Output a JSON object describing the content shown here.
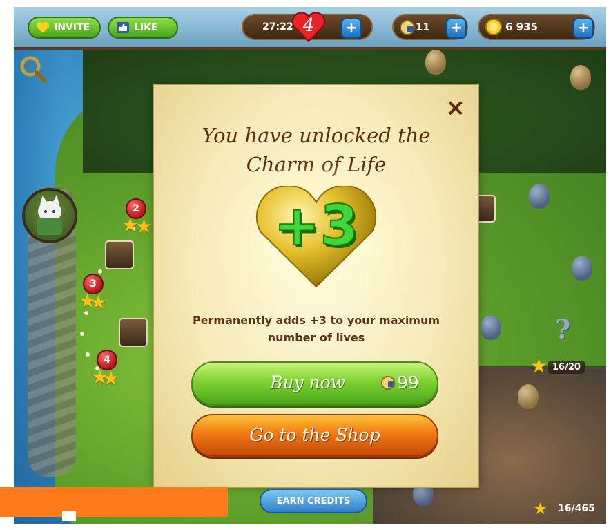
{
  "topbar": {
    "invite_label": "INVITE",
    "like_label": "LIKE",
    "timer": "27:22",
    "lives": "4",
    "credits": "11",
    "coins": "6 935"
  },
  "map": {
    "levels": [
      "2",
      "3",
      "4"
    ],
    "star_counter": "16/20",
    "total_stars": "16/465"
  },
  "dialog": {
    "title_line1": "You have unlocked the",
    "title_line2": "Charm of Life",
    "badge": "+3",
    "description": "Permanently adds +3 to your maximum number of lives",
    "buy_label": "Buy now",
    "buy_price": "99",
    "shop_label": "Go to the Shop"
  },
  "bottom": {
    "earn_label": "EARN CREDITS"
  },
  "colors": {
    "accent_green": "#47a51a",
    "accent_orange": "#f07a12",
    "accent_blue": "#1c6fbd",
    "text_brown": "#5a2e12"
  },
  "icons": [
    "heart-icon",
    "like-icon",
    "plus-icon",
    "credit-icon",
    "coin-icon",
    "magnifier-icon",
    "close-icon",
    "star-icon"
  ]
}
